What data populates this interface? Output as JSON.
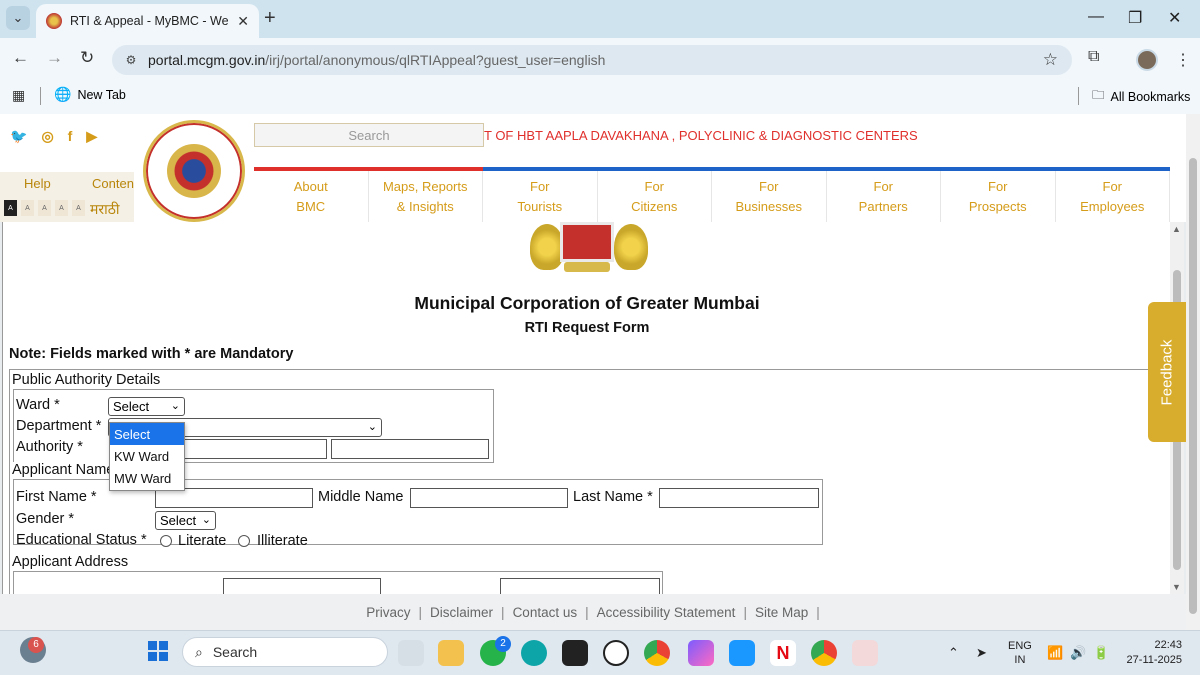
{
  "browser": {
    "tab_title": "RTI & Appeal - MyBMC - Welco",
    "url_domain": "portal.mcgm.gov.in",
    "url_path": "/irj/portal/anonymous/qlRTIAppeal?guest_user=english",
    "bookmark_new_tab": "New Tab",
    "all_bookmarks": "All Bookmarks"
  },
  "header": {
    "search_placeholder": "Search",
    "ticker": "T OF HBT AAPLA DAVAKHANA , POLYCLINIC & DIAGNOSTIC CENTERS",
    "help": "Help",
    "content": "Conten",
    "marathi": "मराठी",
    "font_sizes": [
      "A",
      "A",
      "A",
      "A",
      "A"
    ],
    "nav": [
      {
        "l1": "About",
        "l2": "BMC"
      },
      {
        "l1": "Maps, Reports",
        "l2": "& Insights"
      },
      {
        "l1": "For",
        "l2": "Tourists"
      },
      {
        "l1": "For",
        "l2": "Citizens"
      },
      {
        "l1": "For",
        "l2": "Businesses"
      },
      {
        "l1": "For",
        "l2": "Partners"
      },
      {
        "l1": "For",
        "l2": "Prospects"
      },
      {
        "l1": "For",
        "l2": "Employees"
      }
    ]
  },
  "form": {
    "title": "Municipal Corporation of Greater Mumbai",
    "subtitle": "RTI Request Form",
    "note": "Note: Fields marked with * are Mandatory",
    "public_authority": {
      "legend": "Public Authority Details",
      "ward_label": "Ward *",
      "ward_value": "Select",
      "department_label": "Department *",
      "authority_label": "Authority *"
    },
    "ward_dropdown": [
      "Select",
      "KW Ward",
      "MW Ward"
    ],
    "applicant_name": {
      "legend": "Applicant Name",
      "first_name": "First Name *",
      "middle_name": "Middle Name",
      "last_name": "Last Name *",
      "gender": "Gender *",
      "gender_value": "Select",
      "edu_status": "Educational Status *",
      "literate": "Literate",
      "illiterate": "Illiterate"
    },
    "address_legend": "Applicant Address"
  },
  "feedback": "Feedback",
  "footer": [
    "Privacy",
    "Disclaimer",
    "Contact us",
    "Accessibility Statement",
    "Site Map"
  ],
  "taskbar": {
    "widget_badge": "6",
    "search": "Search",
    "whatsapp_badge": "2",
    "lang1": "ENG",
    "lang2": "IN",
    "time": "22:43",
    "date": "27-11-2025"
  }
}
